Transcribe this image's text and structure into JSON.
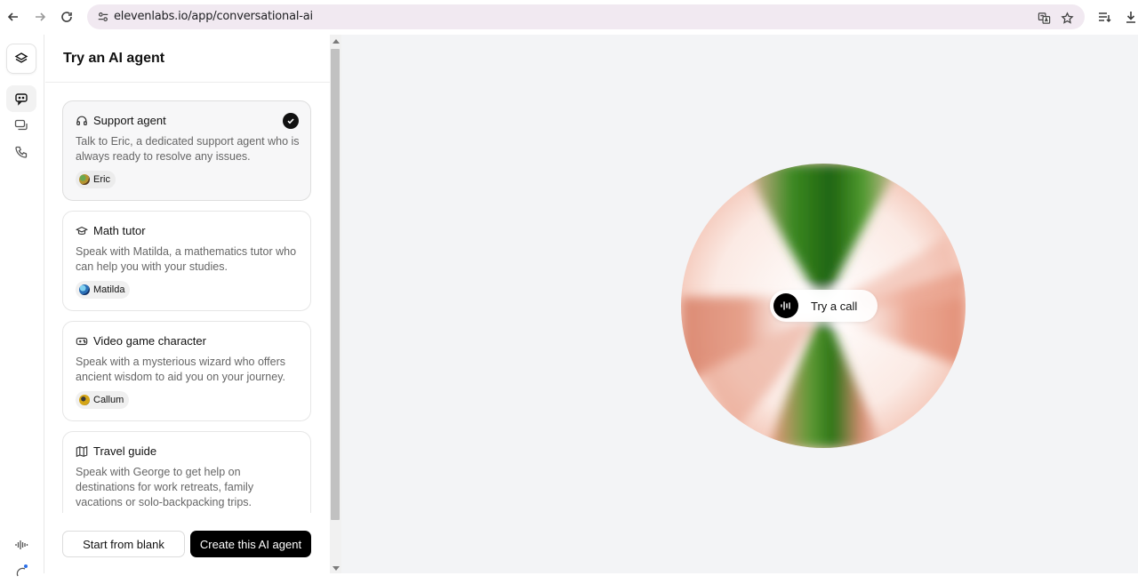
{
  "browser": {
    "url": "elevenlabs.io/app/conversational-ai"
  },
  "panel": {
    "title": "Try an AI agent"
  },
  "agents": [
    {
      "title": "Support agent",
      "description": "Talk to Eric, a dedicated support agent who is always ready to resolve any issues.",
      "voice": "Eric",
      "icon": "headset-icon",
      "selected": true,
      "voice_color": "#b4932f"
    },
    {
      "title": "Math tutor",
      "description": "Speak with Matilda, a mathematics tutor who can help you with your studies.",
      "voice": "Matilda",
      "icon": "graduation-cap-icon",
      "selected": false,
      "voice_color": "#2a6fb6"
    },
    {
      "title": "Video game character",
      "description": "Speak with a mysterious wizard who offers ancient wisdom to aid you on your journey.",
      "voice": "Callum",
      "icon": "gamepad-icon",
      "selected": false,
      "voice_color": "#d4a516"
    },
    {
      "title": "Travel guide",
      "description": "Speak with George to get help on destinations for work retreats, family vacations or solo-backpacking trips.",
      "icon": "map-icon",
      "selected": false
    }
  ],
  "footer": {
    "blank_label": "Start from blank",
    "create_label": "Create this AI agent"
  },
  "call": {
    "label": "Try a call"
  },
  "colors": {
    "orb_green": "#2f7a16",
    "orb_salmon": "#e9957d",
    "background": "#f3f4f6",
    "primary": "#000000"
  }
}
